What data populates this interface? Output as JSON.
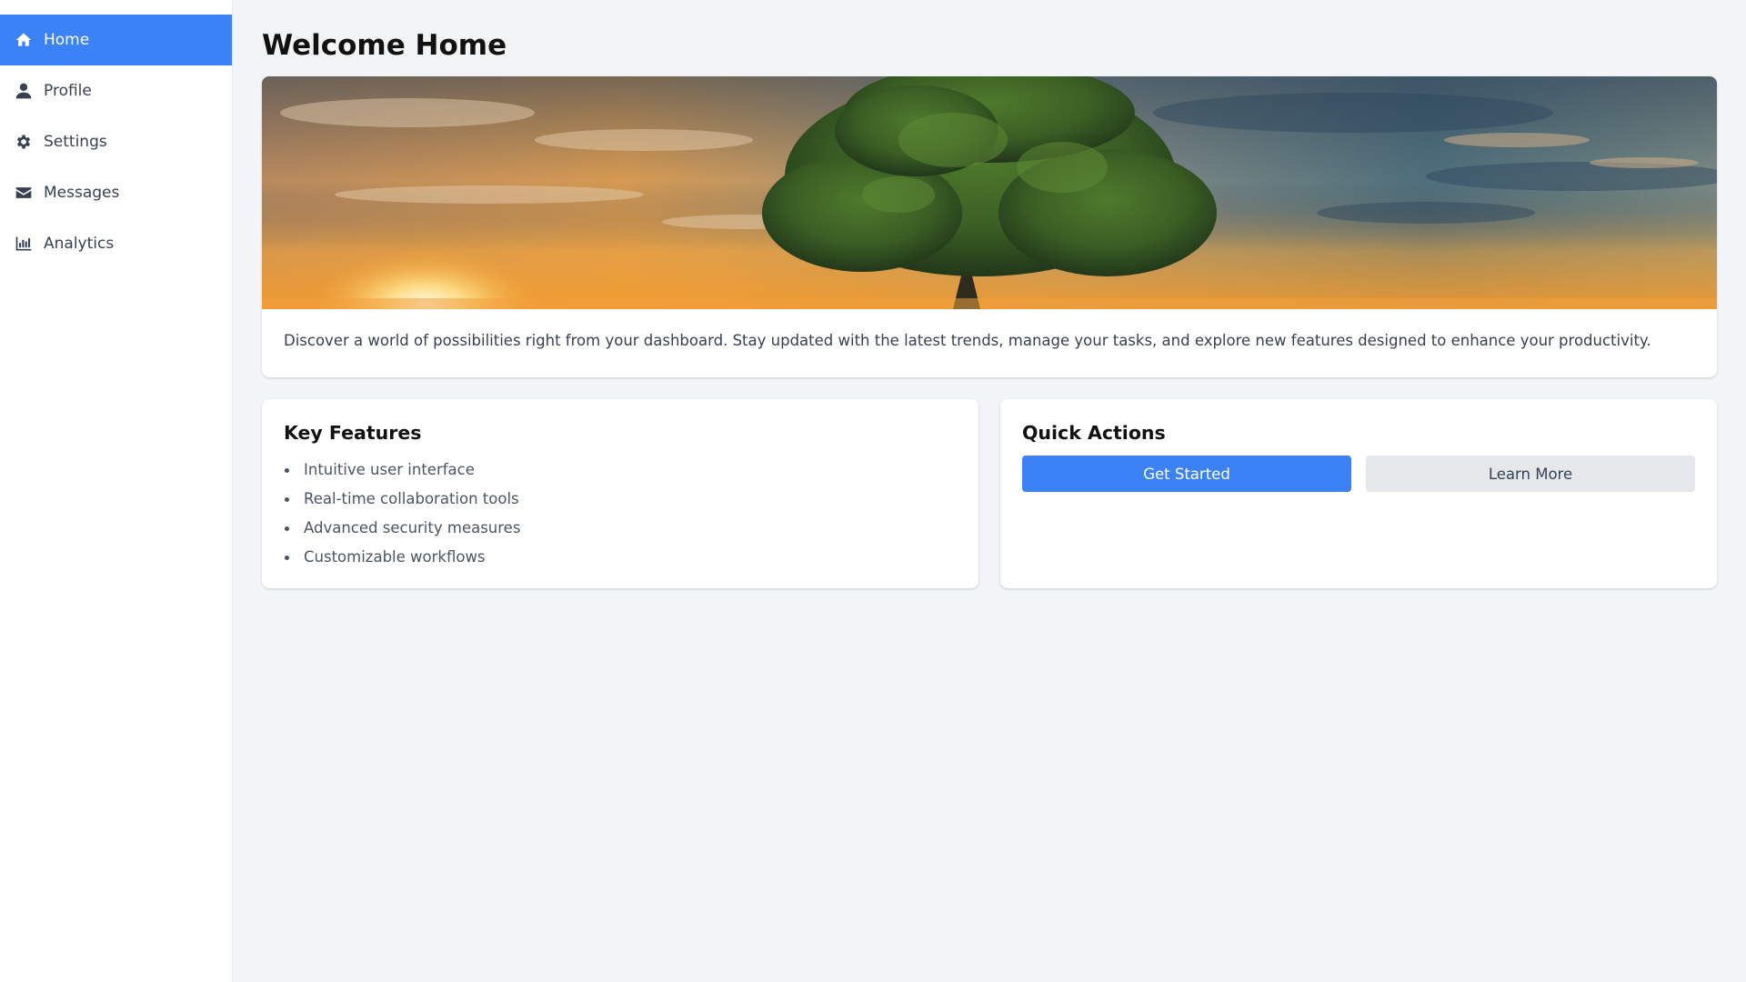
{
  "sidebar": {
    "items": [
      {
        "label": "Home",
        "icon": "home-icon",
        "active": true
      },
      {
        "label": "Profile",
        "icon": "user-icon",
        "active": false
      },
      {
        "label": "Settings",
        "icon": "gear-icon",
        "active": false
      },
      {
        "label": "Messages",
        "icon": "envelope-icon",
        "active": false
      },
      {
        "label": "Analytics",
        "icon": "bar-chart-icon",
        "active": false
      }
    ]
  },
  "main": {
    "title": "Welcome Home",
    "hero": {
      "image": "sunset-tree-landscape",
      "description": "Discover a world of possibilities right from your dashboard. Stay updated with the latest trends, manage your tasks, and explore new features designed to enhance your productivity."
    },
    "key_features": {
      "title": "Key Features",
      "items": [
        "Intuitive user interface",
        "Real-time collaboration tools",
        "Advanced security measures",
        "Customizable workflows"
      ]
    },
    "quick_actions": {
      "title": "Quick Actions",
      "primary_label": "Get Started",
      "secondary_label": "Learn More"
    }
  },
  "colors": {
    "accent": "#3b82f6",
    "background": "#f3f4f6",
    "card": "#ffffff",
    "secondary_button": "#e5e7eb"
  }
}
